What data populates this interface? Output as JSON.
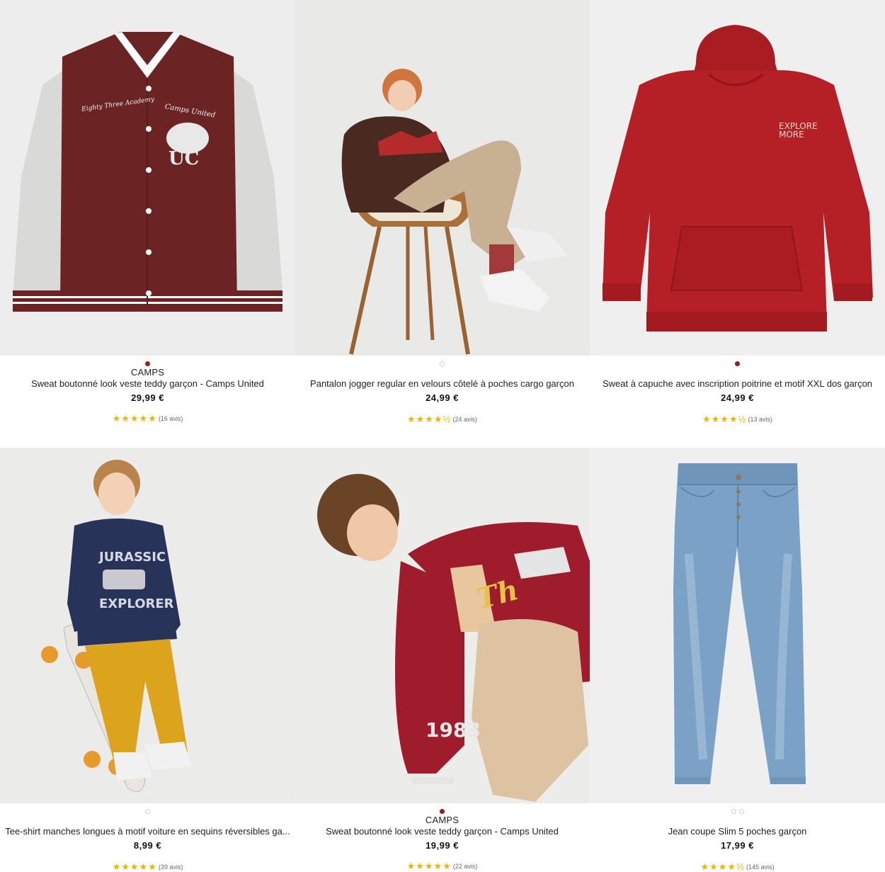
{
  "products": [
    {
      "brand": "CAMPS",
      "title": "Sweat boutonné look veste teddy garçon - Camps United",
      "price": "29,99 €",
      "stars": "★★★★★",
      "reviews": "(16 avis)",
      "image_label": "Veste teddy bordeaux manches grises",
      "image_print_1": "Eighty Three Academy",
      "image_print_2": "Camps United",
      "image_print_3": "UC",
      "dots": [
        "active"
      ]
    },
    {
      "brand": "",
      "title": "Pantalon jogger regular en velours côtelé à poches cargo garçon",
      "price": "24,99 €",
      "stars": "★★★★½",
      "reviews": "(24 avis)",
      "image_label": "Garçon assis sur chaise, pantalon beige",
      "dots": [
        "hollow"
      ]
    },
    {
      "brand": "",
      "title": "Sweat à capuche avec inscription poitrine et motif XXL dos garçon",
      "price": "24,99 €",
      "stars": "★★★★½",
      "reviews": "(13 avis)",
      "image_label": "Sweat à capuche rouge",
      "image_print_1": "EXPLORE",
      "image_print_2": "MORE",
      "dots": [
        "active"
      ]
    },
    {
      "brand": "",
      "title": "Tee-shirt manches longues à motif voiture en sequins réversibles ga...",
      "price": "8,99 €",
      "stars": "★★★★★",
      "reviews": "(39 avis)",
      "image_label": "Garçon avec skateboard, tee-shirt marine",
      "image_print_1": "JURASSIC",
      "image_print_2": "EXPLORER",
      "dots": [
        "hollow"
      ]
    },
    {
      "brand": "CAMPS",
      "title": "Sweat boutonné look veste teddy garçon - Camps United",
      "price": "19,99 €",
      "stars": "★★★★★",
      "reviews": "(22 avis)",
      "image_label": "Garçon en veste teddy rouge",
      "image_print_1": "1983",
      "dots": [
        "active"
      ]
    },
    {
      "brand": "",
      "title": "Jean coupe Slim 5 poches garçon",
      "price": "17,99 €",
      "stars": "★★★★½",
      "reviews": "(145 avis)",
      "image_label": "Jean bleu délavé",
      "dots": [
        "hollow",
        "hollow"
      ]
    }
  ],
  "colors": {
    "active_dot": "#9b1c1c",
    "star": "#f0b400",
    "image_bg": "#eeeeee"
  }
}
